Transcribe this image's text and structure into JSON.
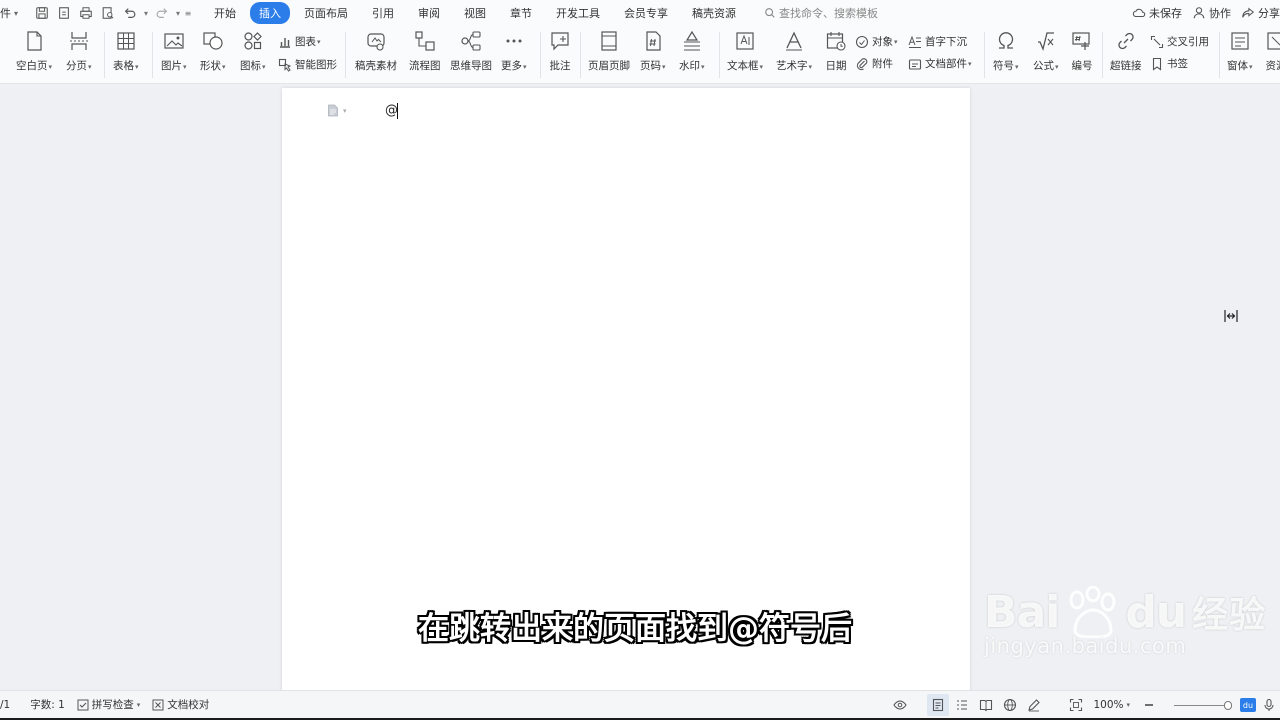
{
  "menubar": {
    "file_label": "件",
    "tabs": [
      {
        "label": "开始"
      },
      {
        "label": "插入"
      },
      {
        "label": "页面布局"
      },
      {
        "label": "引用"
      },
      {
        "label": "审阅"
      },
      {
        "label": "视图"
      },
      {
        "label": "章节"
      },
      {
        "label": "开发工具"
      },
      {
        "label": "会员专享"
      },
      {
        "label": "稿壳资源"
      }
    ],
    "active_tab": "插入",
    "search_placeholder": "查找命令、搜索模板",
    "unsaved": "未保存",
    "collaborate": "协作",
    "share": "分享"
  },
  "ribbon": {
    "blank_page": "空白页",
    "page_break": "分页",
    "table": "表格",
    "picture": "图片",
    "shape": "形状",
    "icon": "图标",
    "chart": "图表",
    "smart_art": "智能图形",
    "materials": "稿壳素材",
    "flowchart": "流程图",
    "mindmap": "思维导图",
    "more": "更多",
    "comment": "批注",
    "header_footer": "页眉页脚",
    "page_number": "页码",
    "watermark": "水印",
    "textbox": "文本框",
    "wordart": "艺术字",
    "date": "日期",
    "object": "对象",
    "attachment": "附件",
    "dropcap": "首字下沉",
    "doc_parts": "文档部件",
    "symbol": "符号",
    "formula": "公式",
    "numbering": "编号",
    "hyperlink": "超链接",
    "cross_ref": "交叉引用",
    "bookmark": "书签",
    "font_style": "窗体",
    "resource": "资源"
  },
  "document": {
    "content": "@"
  },
  "caption": "在跳转出来的页面找到@符号后",
  "watermark": {
    "logo_left": "Bai",
    "logo_right": "du",
    "logo_cn": "经验",
    "url": "jingyan.baidu.com"
  },
  "statusbar": {
    "page": "/1",
    "word_count": "字数: 1",
    "spell_check": "拼写检查",
    "doc_proof": "文档校对",
    "zoom": "100%",
    "du": "du"
  },
  "colors": {
    "accent": "#2b7de9",
    "background": "#eef0f3"
  }
}
